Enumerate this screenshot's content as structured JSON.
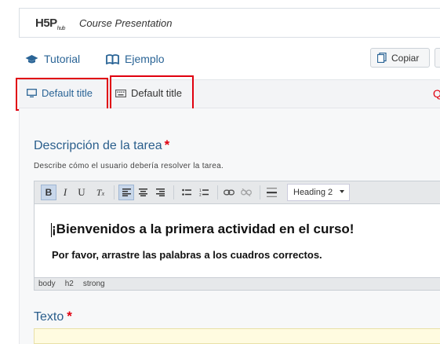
{
  "header": {
    "logo_main": "H5P",
    "logo_sub": "hub",
    "title": "Course Presentation"
  },
  "links": {
    "tutorial": "Tutorial",
    "example": "Ejemplo",
    "copy": "Copiar"
  },
  "tabs": [
    {
      "label": "Default title",
      "icon": "monitor-icon",
      "active": true
    },
    {
      "label": "Default title",
      "icon": "keyboard-icon",
      "active": false
    }
  ],
  "form": {
    "task_label": "Descripción de la tarea",
    "required_mark": "*",
    "task_help": "Describe cómo el usuario debería resolver la tarea.",
    "text_label": "Texto"
  },
  "editor": {
    "format_select": "Heading 2",
    "heading": "¡Bienvenidos a la primera actividad en el curso!",
    "paragraph": "Por favor, arrastre las palabras a los cuadros correctos.",
    "path": [
      "body",
      "h2",
      "strong"
    ]
  },
  "colors": {
    "accent": "#2a5e8c",
    "required": "#e0000f",
    "highlight_box": "#e0000f"
  }
}
